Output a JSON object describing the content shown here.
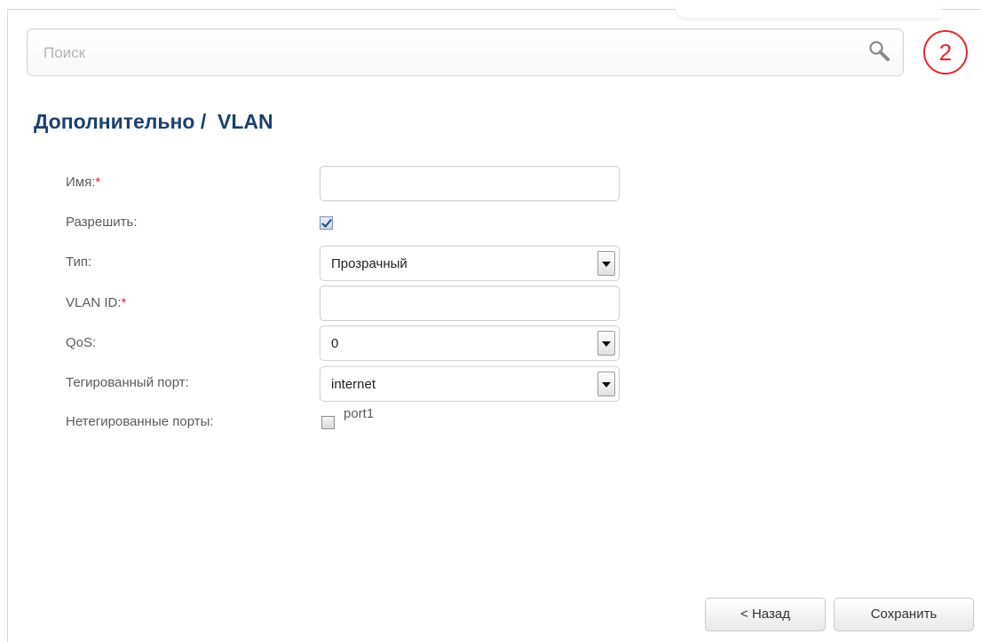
{
  "search": {
    "placeholder": "Поиск",
    "icon": "search-icon"
  },
  "notifications": {
    "count": "2",
    "color": "#e8262a"
  },
  "page": {
    "title": "Дополнительно /  VLAN"
  },
  "form": {
    "name": {
      "label": "Имя:",
      "required": "*",
      "value": ""
    },
    "enable": {
      "label": "Разрешить:",
      "checked": true
    },
    "type": {
      "label": "Тип:",
      "value": "Прозрачный"
    },
    "vlan_id": {
      "label": "VLAN ID:",
      "required": "*",
      "value": ""
    },
    "qos": {
      "label": "QoS:",
      "value": "0"
    },
    "tagged_port": {
      "label": "Тегированный порт:",
      "value": "internet"
    },
    "untagged_ports": {
      "label": "Нетегированные порты:",
      "ports": [
        {
          "name": "port1",
          "checked": false
        }
      ]
    }
  },
  "buttons": {
    "back": "< Назад",
    "save": "Сохранить"
  },
  "colors": {
    "title": "#1c3f6e",
    "required": "#e8262a"
  }
}
